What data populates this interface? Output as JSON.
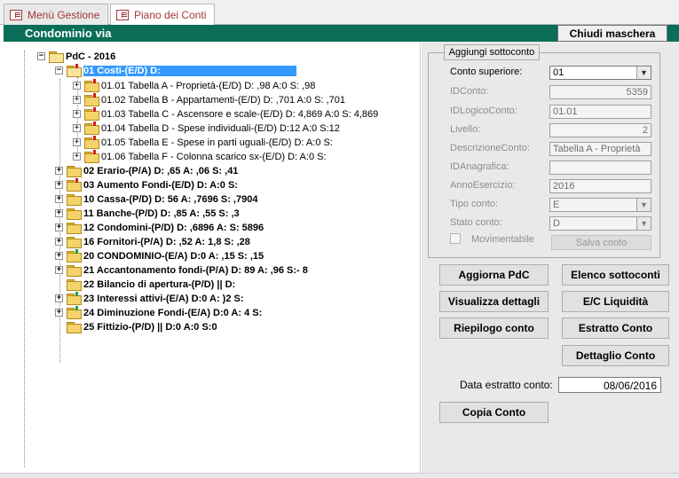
{
  "tabs": [
    {
      "label": "Menù Gestione",
      "active": false
    },
    {
      "label": "Piano dei Conti",
      "active": true
    }
  ],
  "header": {
    "title": "Condominio via",
    "close_button": "Chiudi maschera",
    "band_color": "#0a6e58"
  },
  "tree": {
    "root": {
      "label": "PdC - 2016",
      "expander": "−"
    },
    "selected": {
      "label": "01 Costi-(E/D) D:",
      "expander": "−"
    },
    "children_01": [
      {
        "label": "01.01 Tabella A - Proprietà-(E/D) D:      ,98 A:0 S:      ,98"
      },
      {
        "label": "01.02 Tabella B - Appartamenti-(E/D) D:      ,701 A:0 S:      ,701"
      },
      {
        "label": "01.03 Tabella C - Ascensore e scale-(E/D) D:      4,869 A:0 S:      4,869"
      },
      {
        "label": "01.04 Tabella D - Spese individuali-(E/D) D:12 A:0 S:12"
      },
      {
        "label": "01.05 Tabella E - Spese in parti uguali-(E/D) D:      A:0 S:"
      },
      {
        "label": "01.06 Tabella F - Colonna scarico sx-(E/D) D:      A:0 S:"
      }
    ],
    "accounts": [
      {
        "label": "02 Erario-(P/A) D:      ,65 A:      ,06 S:      ,41"
      },
      {
        "label": "03 Aumento Fondi-(E/D) D:      A:0 S:"
      },
      {
        "label": "10 Cassa-(P/D) D:      56 A:      ,7696 S:      ,7904"
      },
      {
        "label": "11 Banche-(P/D) D:      ,85 A:      ,55 S:      ,3"
      },
      {
        "label": "12 Condomini-(P/D) D:      ,6896 A:      S:      5896"
      },
      {
        "label": "16 Fornitori-(P/A) D:      ,52 A:      1,8 S:      ,28"
      },
      {
        "label": "20 CONDOMINIO-(E/A) D:0 A:      ,15 S:      ,15"
      },
      {
        "label": "21 Accantonamento fondi-(P/A) D:      89 A:      ,96 S:-      8"
      },
      {
        "label": "22 Bilancio di apertura-(P/D) || D:"
      },
      {
        "label": "23 Interessi attivi-(E/A) D:0 A:      )2 S:"
      },
      {
        "label": "24 Diminuzione Fondi-(E/A) D:0 A:      4 S:"
      },
      {
        "label": "25 Fittizio-(P/D) || D:0 A:0 S:0"
      }
    ]
  },
  "form": {
    "group_title": "Aggiungi sottoconto",
    "conto_superiore": {
      "label": "Conto superiore:",
      "value": "01"
    },
    "id_conto": {
      "label": "IDConto:",
      "value": "5359"
    },
    "id_logico": {
      "label": "IDLogicoConto:",
      "value": "01.01"
    },
    "livello": {
      "label": "Livello:",
      "value": "2"
    },
    "descrizione": {
      "label": "DescrizioneConto:",
      "value": "Tabella A - Proprietà"
    },
    "id_anagrafica": {
      "label": "IDAnagrafica:",
      "value": ""
    },
    "anno": {
      "label": "AnnoEsercizio:",
      "value": "2016"
    },
    "tipo": {
      "label": "Tipo conto:",
      "value": "E"
    },
    "stato": {
      "label": "Stato conto:",
      "value": "D"
    },
    "movimentabile": {
      "label": "Movimentabile"
    },
    "salva": "Salva conto"
  },
  "actions": {
    "aggiorna": "Aggiorna PdC",
    "elenco": "Elenco sottoconti",
    "visualizza": "Visualizza dettagli",
    "ec": "E/C Liquidità",
    "riepilogo": "Riepilogo conto",
    "estratto": "Estratto Conto",
    "dettaglio": "Dettaglio Conto",
    "copia": "Copia Conto"
  },
  "date": {
    "label": "Data estratto conto:",
    "value": "08/06/2016"
  }
}
